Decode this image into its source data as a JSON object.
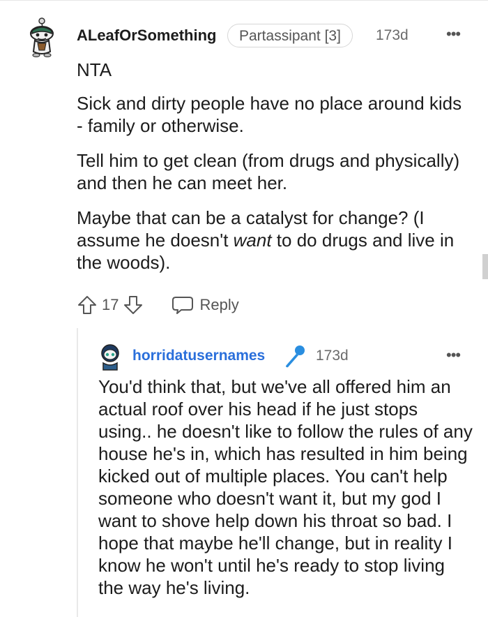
{
  "comment": {
    "username": "ALeafOrSomething",
    "flair": "Partassipant [3]",
    "time": "173d",
    "more": "•••",
    "paragraphs": [
      "NTA",
      "Sick and dirty people have no place around kids - family or otherwise.",
      "Tell him to get clean (from drugs and physically) and then he can meet her."
    ],
    "last_paragraph": {
      "before": "Maybe that can be a catalyst for change? (I assume he doesn't ",
      "emphasis": "want",
      "after": " to do drugs and live in the woods)."
    },
    "votes": "17",
    "reply_label": "Reply"
  },
  "reply": {
    "username": "horridatusernames",
    "time": "173d",
    "more": "•••",
    "text": "You'd think that, but we've all offered him an actual roof over his head if he just stops using.. he doesn't like to follow the rules of any house he's in, which has resulted in him being kicked out of multiple places. You can't help someone who doesn't want it, but my god I want to shove help down his throat so bad. I hope that maybe he'll change, but in reality I know he won't until he's ready to stop living the way he's living."
  },
  "icons": {
    "avatar1": "snoo-avatar-icon",
    "avatar2": "snoo-avatar-icon",
    "upvote": "upvote-arrow-icon",
    "downvote": "downvote-arrow-icon",
    "reply": "chat-bubble-icon",
    "flair_badge": "microphone-icon"
  },
  "colors": {
    "username_reply": "#2a6fdb",
    "mic": "#2a8ee0"
  }
}
